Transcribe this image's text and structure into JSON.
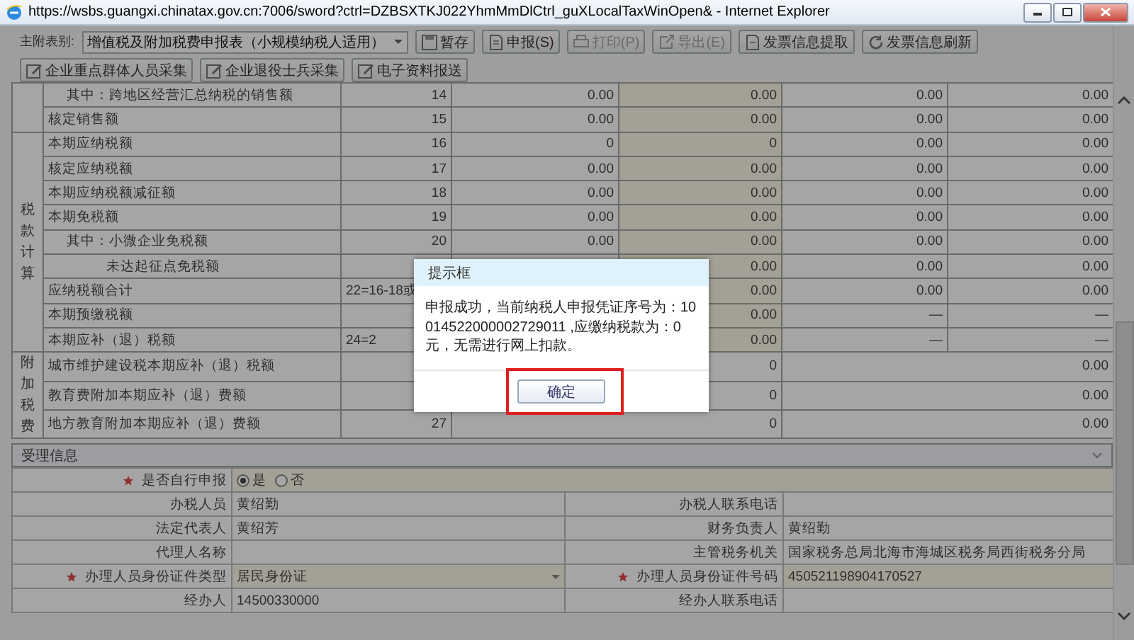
{
  "window": {
    "title": "https://wsbs.guangxi.chinatax.gov.cn:7006/sword?ctrl=DZBSXTKJ022YhmMmDlCtrl_guXLocalTaxWinOpen& - Internet Explorer"
  },
  "toolbar": {
    "select_label": "主附表别:",
    "select_value": "增值税及附加税费申报表（小规模纳税人适用）",
    "buttons": [
      {
        "label": "暂存",
        "disabled": false
      },
      {
        "label": "申报(S)",
        "disabled": false
      },
      {
        "label": "打印(P)",
        "disabled": true
      },
      {
        "label": "导出(E)",
        "disabled": true
      },
      {
        "label": "发票信息提取",
        "disabled": false
      },
      {
        "label": "发票信息刷新",
        "disabled": false
      },
      {
        "label": "企业重点群体人员采集",
        "disabled": false
      },
      {
        "label": "企业退役士兵采集",
        "disabled": false
      },
      {
        "label": "电子资料报送",
        "disabled": false
      }
    ]
  },
  "table": {
    "groups": [
      {
        "rows": [
          {
            "kind": "normal",
            "label": "其中：跨地区经营汇总纳税的销售额",
            "indented": true,
            "deeply_indented": false,
            "number": "14",
            "values": [
              "0.00",
              "0.00",
              "0.00",
              "0.00"
            ]
          },
          {
            "kind": "normal",
            "label": "核定销售额",
            "indented": false,
            "deeply_indented": false,
            "number": "15",
            "values": [
              "0.00",
              "0.00",
              "0.00",
              "0.00"
            ]
          }
        ]
      },
      {
        "label": "税款计算",
        "rows": [
          {
            "kind": "normal",
            "label": "本期应纳税额",
            "indented": false,
            "deeply_indented": false,
            "number": "16",
            "values": [
              "0",
              "0",
              "0.00",
              "0.00"
            ]
          },
          {
            "kind": "normal",
            "label": "核定应纳税额",
            "indented": false,
            "deeply_indented": false,
            "number": "17",
            "values": [
              "0.00",
              "0.00",
              "0.00",
              "0.00"
            ]
          },
          {
            "kind": "normal",
            "label": "本期应纳税额减征额",
            "indented": false,
            "deeply_indented": false,
            "number": "18",
            "values": [
              "0.00",
              "0.00",
              "0.00",
              "0.00"
            ]
          },
          {
            "kind": "normal",
            "label": "本期免税额",
            "indented": false,
            "deeply_indented": false,
            "number": "19",
            "values": [
              "0.00",
              "0.00",
              "0.00",
              "0.00"
            ]
          },
          {
            "kind": "normal",
            "label": "其中：小微企业免税额",
            "indented": true,
            "deeply_indented": false,
            "number": "20",
            "values": [
              "0.00",
              "0.00",
              "0.00",
              "0.00"
            ]
          },
          {
            "kind": "covered",
            "label": "未达起征点免税额",
            "indented": true,
            "deeply_indented": true,
            "values": [
              "0.00",
              "0.00",
              "0.00"
            ]
          },
          {
            "kind": "covered",
            "label": "应纳税额合计",
            "indented": false,
            "deeply_indented": false,
            "number": "22=16-18或",
            "values": [
              "0.00",
              "0.00",
              "0.00"
            ]
          },
          {
            "kind": "covered",
            "label": "本期预缴税额",
            "indented": false,
            "deeply_indented": false,
            "values": [
              "0.00",
              "—",
              "—"
            ]
          },
          {
            "kind": "covered",
            "label": "本期应补（退）税额",
            "indented": false,
            "deeply_indented": false,
            "number": "24=2",
            "values": [
              "0.00",
              "—",
              "—"
            ]
          }
        ]
      },
      {
        "label": "附加税费",
        "rows": [
          {
            "kind": "merged",
            "label": "城市维护建设税本期应补（退）税额",
            "indented": false,
            "deeply_indented": false,
            "values": [
              "0",
              "0.00"
            ]
          },
          {
            "kind": "merged",
            "label": "教育费附加本期应补（退）费额",
            "indented": false,
            "deeply_indented": false,
            "values": [
              "0",
              "0.00"
            ]
          },
          {
            "kind": "merged",
            "label": "地方教育附加本期应补（退）费额",
            "indented": false,
            "deeply_indented": false,
            "number": "27",
            "values": [
              "0",
              "0.00"
            ]
          }
        ]
      }
    ]
  },
  "handler": {
    "title": "受理信息",
    "own_filing": {
      "label": "是否自行申报",
      "required": true,
      "options": [
        {
          "label": "是",
          "selected": true
        },
        {
          "label": "否",
          "selected": false
        }
      ]
    },
    "fields": [
      {
        "label": "办税人员",
        "value": "黄绍勤"
      },
      {
        "label": "办税人联系电话"
      },
      {
        "label": "法定代表人",
        "value": "黄绍芳"
      },
      {
        "label": "财务负责人",
        "value": "黄绍勤"
      },
      {
        "label": "代理人名称"
      },
      {
        "label": "主管税务机关",
        "value": "国家税务总局北海市海城区税务局西街税务分局"
      },
      {
        "label": "办理人员身份证件类型",
        "required": true,
        "kind": "select",
        "value": "居民身份证"
      },
      {
        "label": "办理人员身份证件号码",
        "required": true,
        "value": "450521198904170527"
      },
      {
        "label": "经办人",
        "value": "14500330000"
      },
      {
        "label": "经办人联系电话"
      }
    ]
  },
  "dialog": {
    "title": "提示框",
    "message": "申报成功，当前纳税人申报凭证序号为：10014522000002729011 ,应缴纳税款为：0元，无需进行网上扣款。",
    "button": "确定"
  }
}
